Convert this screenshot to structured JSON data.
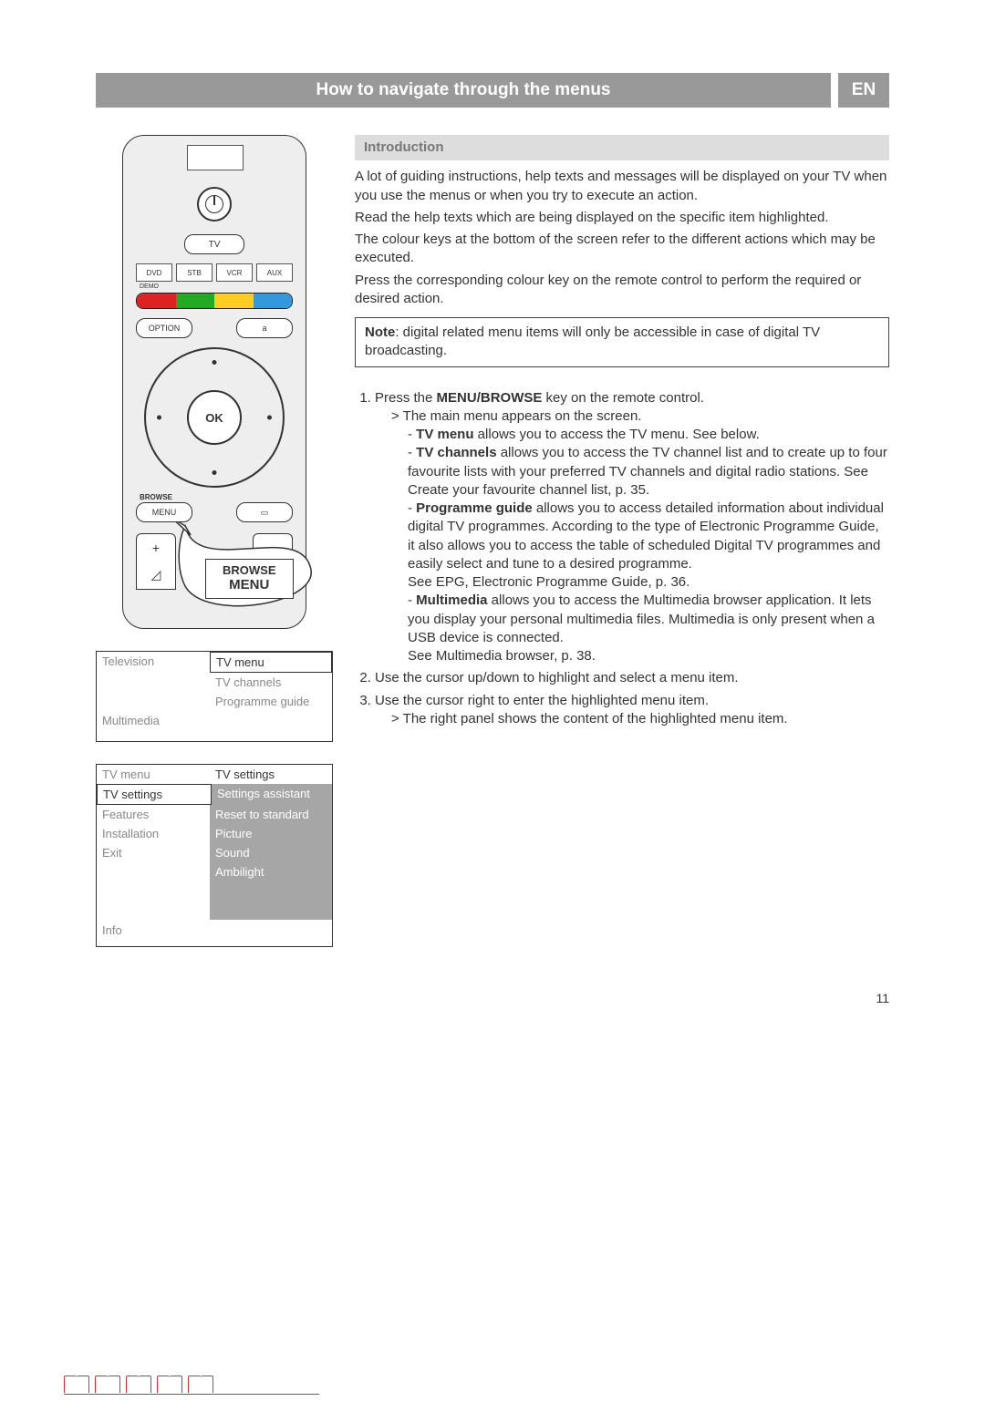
{
  "header": {
    "title": "How to navigate through the menus",
    "lang": "EN"
  },
  "section_heading": "Introduction",
  "intro": {
    "p1": "A lot of guiding instructions, help texts and messages will be displayed on your TV when you use the menus or when you try to execute an action.",
    "p2": "Read the help texts which are being displayed on the specific item highlighted.",
    "p3": "The colour keys at the bottom of the screen refer to the different actions which may be executed.",
    "p4": "Press the corresponding colour key on the remote control to perform the required or desired action."
  },
  "note": {
    "label": "Note",
    "text": ": digital related menu items will only be accessible in case of digital TV broadcasting."
  },
  "steps": {
    "s1": {
      "lead": "Press the ",
      "bold": "MENU/BROWSE",
      "rest": " key on the remote control."
    },
    "s1_sub": "The main menu appears on the screen.",
    "s1_a": {
      "bold": "TV menu",
      "rest": " allows you to access the TV menu. See below."
    },
    "s1_b": {
      "bold": "TV channels",
      "rest": " allows you to access the TV channel list and to create up to four favourite lists with your preferred TV channels and digital radio stations. See Create your favourite channel list, p. 35."
    },
    "s1_c": {
      "bold": "Programme guide",
      "rest": " allows you to access detailed information about individual digital TV programmes. According to the type of Electronic Programme Guide, it also allows you to access the table of scheduled Digital TV programmes and easily select and tune to a desired programme."
    },
    "s1_c_see": "See EPG, Electronic Programme Guide, p. 36.",
    "s1_d": {
      "bold": "Multimedia",
      "rest": " allows you to access the Multimedia browser application. It lets you display your personal multimedia files. Multimedia is only present when a USB device is connected."
    },
    "s1_d_see": "See Multimedia browser, p. 38.",
    "s2": "Use the cursor up/down to highlight and select a menu item.",
    "s3": "Use the cursor right to enter the highlighted menu item.",
    "s3_sub": "The right panel shows the content of the highlighted menu item."
  },
  "remote": {
    "tv": "TV",
    "sources": [
      "DVD",
      "STB",
      "VCR",
      "AUX"
    ],
    "demo": "DEMO",
    "option": "OPTION",
    "a": "a",
    "ok": "OK",
    "browse": "BROWSE",
    "menu_small": "MENU",
    "callout_line1": "BROWSE",
    "callout_line2": "MENU"
  },
  "menu1": {
    "left": [
      "Television",
      "",
      "",
      "Multimedia"
    ],
    "right": [
      "TV menu",
      "TV channels",
      "Programme guide",
      ""
    ]
  },
  "menu2": {
    "header_left": "TV menu",
    "header_right": "TV settings",
    "left": [
      "TV settings",
      "Features",
      "Installation",
      "Exit"
    ],
    "right": [
      "Settings assistant",
      "Reset to standard",
      "Picture",
      "Sound",
      "Ambilight"
    ],
    "info": "Info"
  },
  "page_number": "11"
}
